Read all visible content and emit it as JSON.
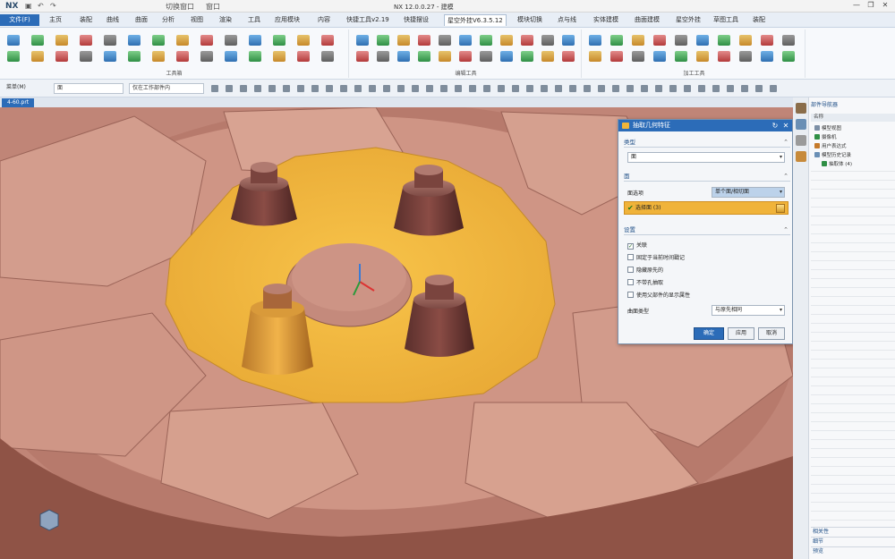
{
  "app": {
    "logo": "NX",
    "window_title": "NX 12.0.0.27 - 建模",
    "quick_access": [
      "切换窗口",
      "窗口"
    ],
    "window_controls": [
      "—",
      "❐",
      "✕"
    ]
  },
  "tabs": {
    "file": "文件(F)",
    "items": [
      "主页",
      "装配",
      "曲线",
      "曲面",
      "分析",
      "视图",
      "渲染",
      "工具",
      "应用模块",
      "内容",
      "快捷工具v2.19",
      "快捷摆设",
      "星空外挂V6.3.5.12",
      "模块切换",
      "点与线",
      "实体建模",
      "曲面建模",
      "星空外挂",
      "草图工具",
      "装配"
    ],
    "active_index": 12
  },
  "ribbon": {
    "group_labels": [
      "工具箱",
      "编辑工具",
      "加工工具"
    ]
  },
  "selection_bar": {
    "menu_label": "菜单(M)",
    "filter_value": "面",
    "scope_value": "仅在工作部件内"
  },
  "doc_tab": {
    "label": "4-60.prt"
  },
  "dialog": {
    "title": "抽取几何特征",
    "type_section": "类型",
    "type_value": "面",
    "face_section": "面",
    "face_option_label": "面选项",
    "face_option_value": "单个面/相切面",
    "select_face_label": "选择面 (3)",
    "settings_section": "设置",
    "checkboxes": [
      {
        "label": "关联",
        "checked": true
      },
      {
        "label": "固定于当前时间戳记",
        "checked": false
      },
      {
        "label": "隐藏原先的",
        "checked": false
      },
      {
        "label": "不带孔抽取",
        "checked": false
      },
      {
        "label": "使用父部件的显示属性",
        "checked": false
      }
    ],
    "surface_type_label": "曲面类型",
    "surface_type_value": "与原先相同",
    "ok_label": "确定",
    "apply_label": "应用",
    "cancel_label": "取消"
  },
  "navigator": {
    "title": "部件导航器",
    "column": "名称",
    "items": [
      "模型视图",
      "摄像机",
      "用户表达式",
      "模型历史记录",
      "抽取体 (4)"
    ],
    "bottom_items": [
      "相关性",
      "细节",
      "预览"
    ]
  },
  "colors": {
    "accent": "#2c6cb8",
    "model_body": "#c38678",
    "highlight": "#f2b940"
  }
}
